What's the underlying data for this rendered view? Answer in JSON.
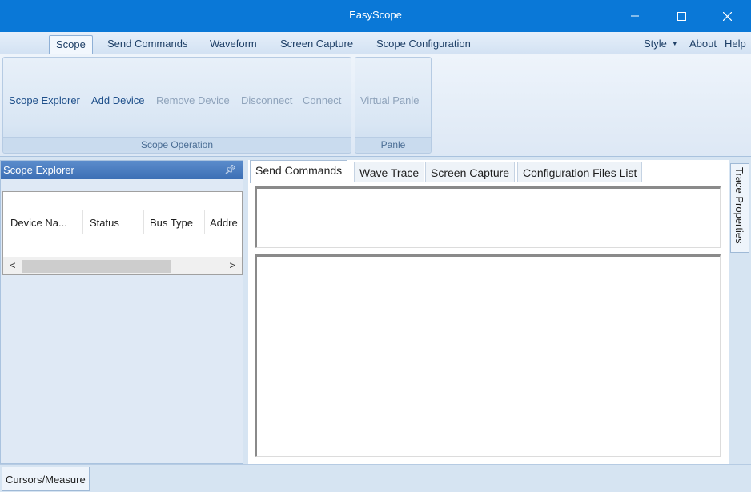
{
  "window": {
    "title": "EasyScope"
  },
  "menu": {
    "tabs": [
      "Scope",
      "Send Commands",
      "Waveform",
      "Screen Capture",
      "Scope Configuration"
    ],
    "right": {
      "style": "Style",
      "about": "About",
      "help": "Help"
    }
  },
  "ribbon": {
    "scope_operation": {
      "label": "Scope Operation",
      "buttons": {
        "scope_explorer": "Scope Explorer",
        "add_device": "Add Device",
        "remove_device": "Remove Device",
        "disconnect": "Disconnect",
        "connect": "Connect"
      }
    },
    "panle": {
      "label": "Panle",
      "virtual_panle": "Virtual Panle"
    }
  },
  "explorer": {
    "title": "Scope Explorer",
    "columns": [
      "Device Na...",
      "Status",
      "Bus Type",
      "Addre"
    ]
  },
  "content": {
    "tabs": [
      "Send Commands",
      "Wave Trace",
      "Screen Capture",
      "Configuration Files List"
    ],
    "active_tab": "Send Commands"
  },
  "side": {
    "trace_properties": "Trace Properties"
  },
  "bottom": {
    "cursors_measure": "Cursors/Measure"
  },
  "colors": {
    "titlebar": "#0a78d7",
    "panel_header": "#3c6fb5",
    "ribbon_link": "#1e4f8a",
    "disabled": "#8fa3bb"
  }
}
